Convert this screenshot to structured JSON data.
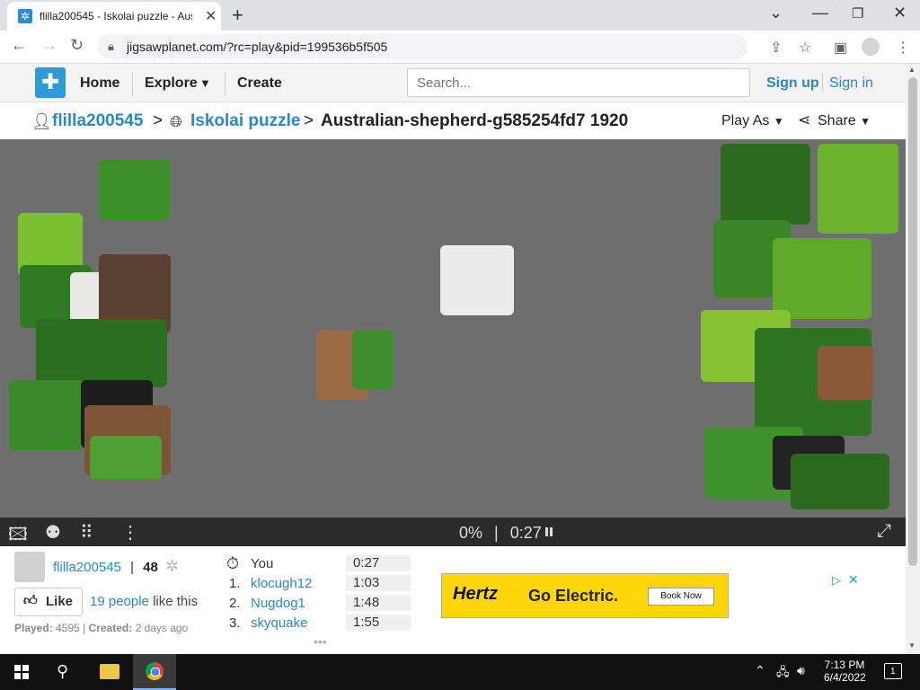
{
  "browser": {
    "tab_title": "flilla200545 - Iskolai puzzle - Aus",
    "url": "jigsawplanet.com/?rc=play&pid=199536b5f505"
  },
  "site_nav": {
    "home": "Home",
    "explore": "Explore",
    "create": "Create",
    "search_placeholder": "Search...",
    "sign_up": "Sign up",
    "sign_in": "Sign in"
  },
  "breadcrumb": {
    "user": "flilla200545",
    "sep1": ">",
    "album": "Iskolai puzzle",
    "sep2": ">",
    "puzzle": "Australian-shepherd-g585254fd7 1920",
    "play_as": "Play As",
    "share": "Share"
  },
  "puzzle_bar": {
    "progress": "0%",
    "divider": "|",
    "timer": "0:27"
  },
  "info": {
    "user": "flilla200545",
    "sep": "|",
    "score": "48",
    "like_label": "Like",
    "likes_link": "19 people",
    "likes_text": "like this",
    "played_label": "Played:",
    "played_count": "4595",
    "created_label": "Created:",
    "created_value": "2 days ago"
  },
  "leaderboard": {
    "you": {
      "name": "You",
      "time": "0:27"
    },
    "entries": [
      {
        "rank": "1.",
        "name": "klocugh12",
        "time": "1:03"
      },
      {
        "rank": "2.",
        "name": "Nugdog1",
        "time": "1:48"
      },
      {
        "rank": "3.",
        "name": "skyquake",
        "time": "1:55"
      }
    ]
  },
  "ad": {
    "brand": "Hertz",
    "tagline": "Go Electric.",
    "cta": "Book Now"
  },
  "taskbar": {
    "time": "7:13 PM",
    "date": "6/4/2022",
    "notifications": "1"
  },
  "colors": {
    "link": "#2a88c8",
    "board": "#6e6e6e",
    "ad_bg": "#ffd60a"
  }
}
